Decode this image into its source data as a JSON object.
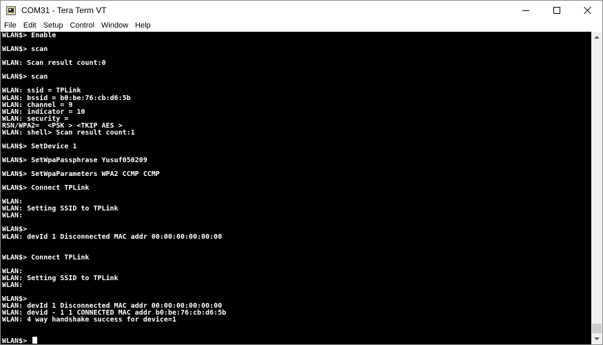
{
  "window": {
    "title": "COM31 - Tera Term VT"
  },
  "menu": [
    "File",
    "Edit",
    "Setup",
    "Control",
    "Window",
    "Help"
  ],
  "terminal": {
    "lines": [
      "WLAN$> Enable",
      "",
      "WLAN$> scan",
      "",
      "WLAN: Scan result count:0",
      "",
      "WLAN$> scan",
      "",
      "WLAN: ssid = TPLink",
      "WLAN: bssid = b0:be:76:cb:d6:5b",
      "WLAN: channel = 9",
      "WLAN: indicator = 10",
      "WLAN: security =",
      "RSN/WPA2=  <PSK > <TKIP AES >",
      "WLAN: shell> Scan result count:1",
      "",
      "WLAN$> SetDevice 1",
      "",
      "WLAN$> SetWpaPassphrase Yusuf050209",
      "",
      "WLAN$> SetWpaParameters WPA2 CCMP CCMP",
      "",
      "WLAN$> Connect TPLink",
      "",
      "WLAN:",
      "WLAN: Setting SSID to TPLink",
      "WLAN:",
      "",
      "WLAN$>",
      "WLAN: devId 1 Disconnected MAC addr 00:00:00:00:00:00",
      "",
      "",
      "WLAN$> Connect TPLink",
      "",
      "WLAN:",
      "WLAN: Setting SSID to TPLink",
      "WLAN:",
      "",
      "WLAN$>",
      "WLAN: devId 1 Disconnected MAC addr 00:00:00:00:00:00",
      "WLAN: devid - 1 1 CONNECTED MAC addr b0:be:76:cb:d6:5b",
      "WLAN: 4 way handshake success for device=1",
      "",
      "",
      "WLAN$> "
    ]
  }
}
